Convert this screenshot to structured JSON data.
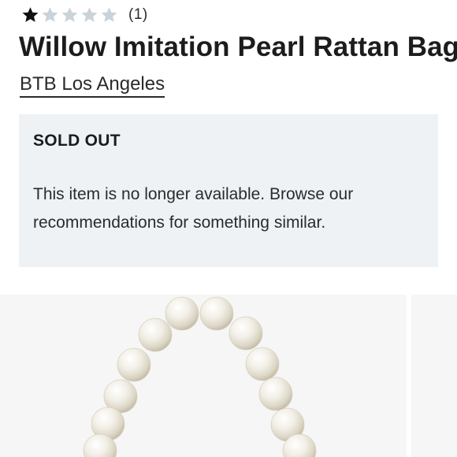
{
  "rating": {
    "value": 1,
    "max": 5,
    "review_count": "(1)",
    "filled_color": "#111111",
    "empty_color": "#c9d3da"
  },
  "product": {
    "title": "Willow Imitation Pearl Rattan Bag",
    "brand": "BTB Los Angeles"
  },
  "notice": {
    "title": "SOLD OUT",
    "message": "This item is no longer available. Browse our recommendations for something similar."
  },
  "gallery": {
    "image_subject": "pearl-bag-handle"
  }
}
